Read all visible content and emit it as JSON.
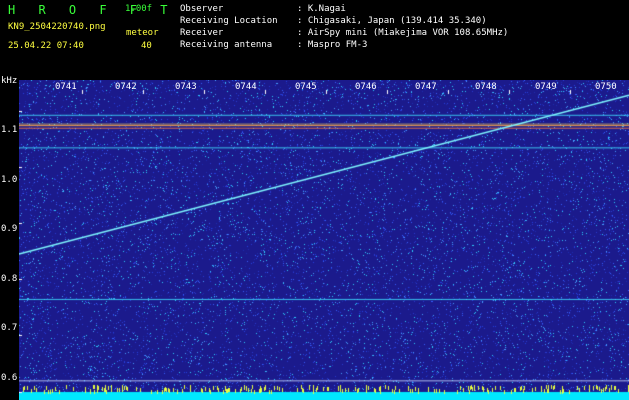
{
  "header": {
    "app_name": "H R O F F T",
    "version": "1.00f",
    "file_name": "KN9_2504220740.png",
    "meteor_label": "meteor",
    "meteor_count": "40",
    "timestamp": "25.04.22 07:40"
  },
  "info": [
    {
      "key": "Observer",
      "value": ": K.Nagai"
    },
    {
      "key": "Receiving Location",
      "value": ": Chigasaki, Japan (139.414 35.340)"
    },
    {
      "key": "Receiver",
      "value": ": AirSpy mini (Miakejima VOR 108.65MHz)"
    },
    {
      "key": "Receiving antenna",
      "value": ": Maspro FM-3"
    }
  ],
  "colors": {
    "background": "#1b1a8c",
    "title": "#39ff39",
    "meta": "#ffff40",
    "info": "#ffffff"
  },
  "chart_data": {
    "type": "heatmap",
    "ylabel": "kHz",
    "y_ticks": [
      "1.1",
      "1.0",
      "0.9",
      "0.8",
      "0.7",
      "0.6"
    ],
    "x_ticks": [
      "0741",
      "0742",
      "0743",
      "0744",
      "0745",
      "0746",
      "0747",
      "0748",
      "0749",
      "0750"
    ],
    "ylim": [
      0.585,
      1.155
    ],
    "x_range_minutes": [
      0,
      10
    ],
    "horizontal_lines_khz": [
      1.093,
      1.075,
      1.07,
      1.035,
      0.765,
      0.62,
      0.595
    ],
    "diagonal_trace": {
      "start": [
        0,
        0.845
      ],
      "end": [
        10,
        1.128
      ]
    }
  }
}
